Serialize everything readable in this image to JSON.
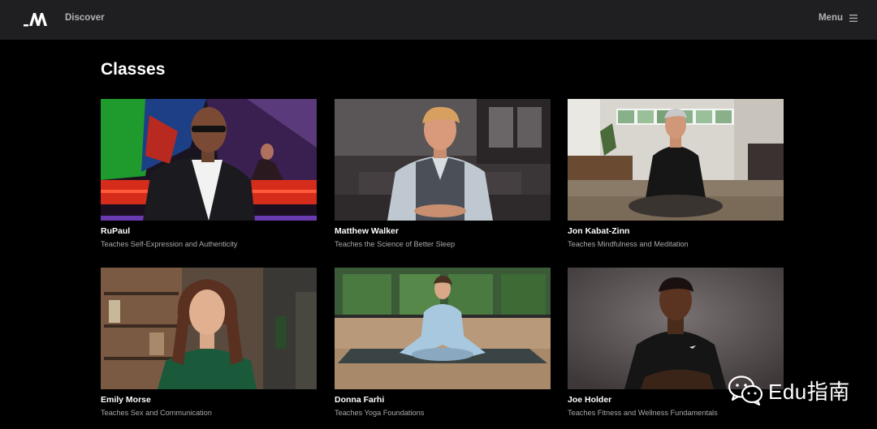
{
  "header": {
    "logo_label": "M",
    "discover_label": "Discover",
    "menu_label": "Menu"
  },
  "page": {
    "title": "Classes"
  },
  "classes": [
    {
      "name": "RuPaul",
      "subtitle": "Teaches Self-Expression and Authenticity"
    },
    {
      "name": "Matthew Walker",
      "subtitle": "Teaches the Science of Better Sleep"
    },
    {
      "name": "Jon Kabat-Zinn",
      "subtitle": "Teaches Mindfulness and Meditation"
    },
    {
      "name": "Emily Morse",
      "subtitle": "Teaches Sex and Communication"
    },
    {
      "name": "Donna Farhi",
      "subtitle": "Teaches Yoga Foundations"
    },
    {
      "name": "Joe Holder",
      "subtitle": "Teaches Fitness and Wellness Fundamentals"
    }
  ],
  "watermark": {
    "text": "Edu指南",
    "icon": "wechat-icon"
  },
  "colors": {
    "background": "#000000",
    "topbar": "#1f1f22",
    "subtitle": "#a9a9ad"
  }
}
